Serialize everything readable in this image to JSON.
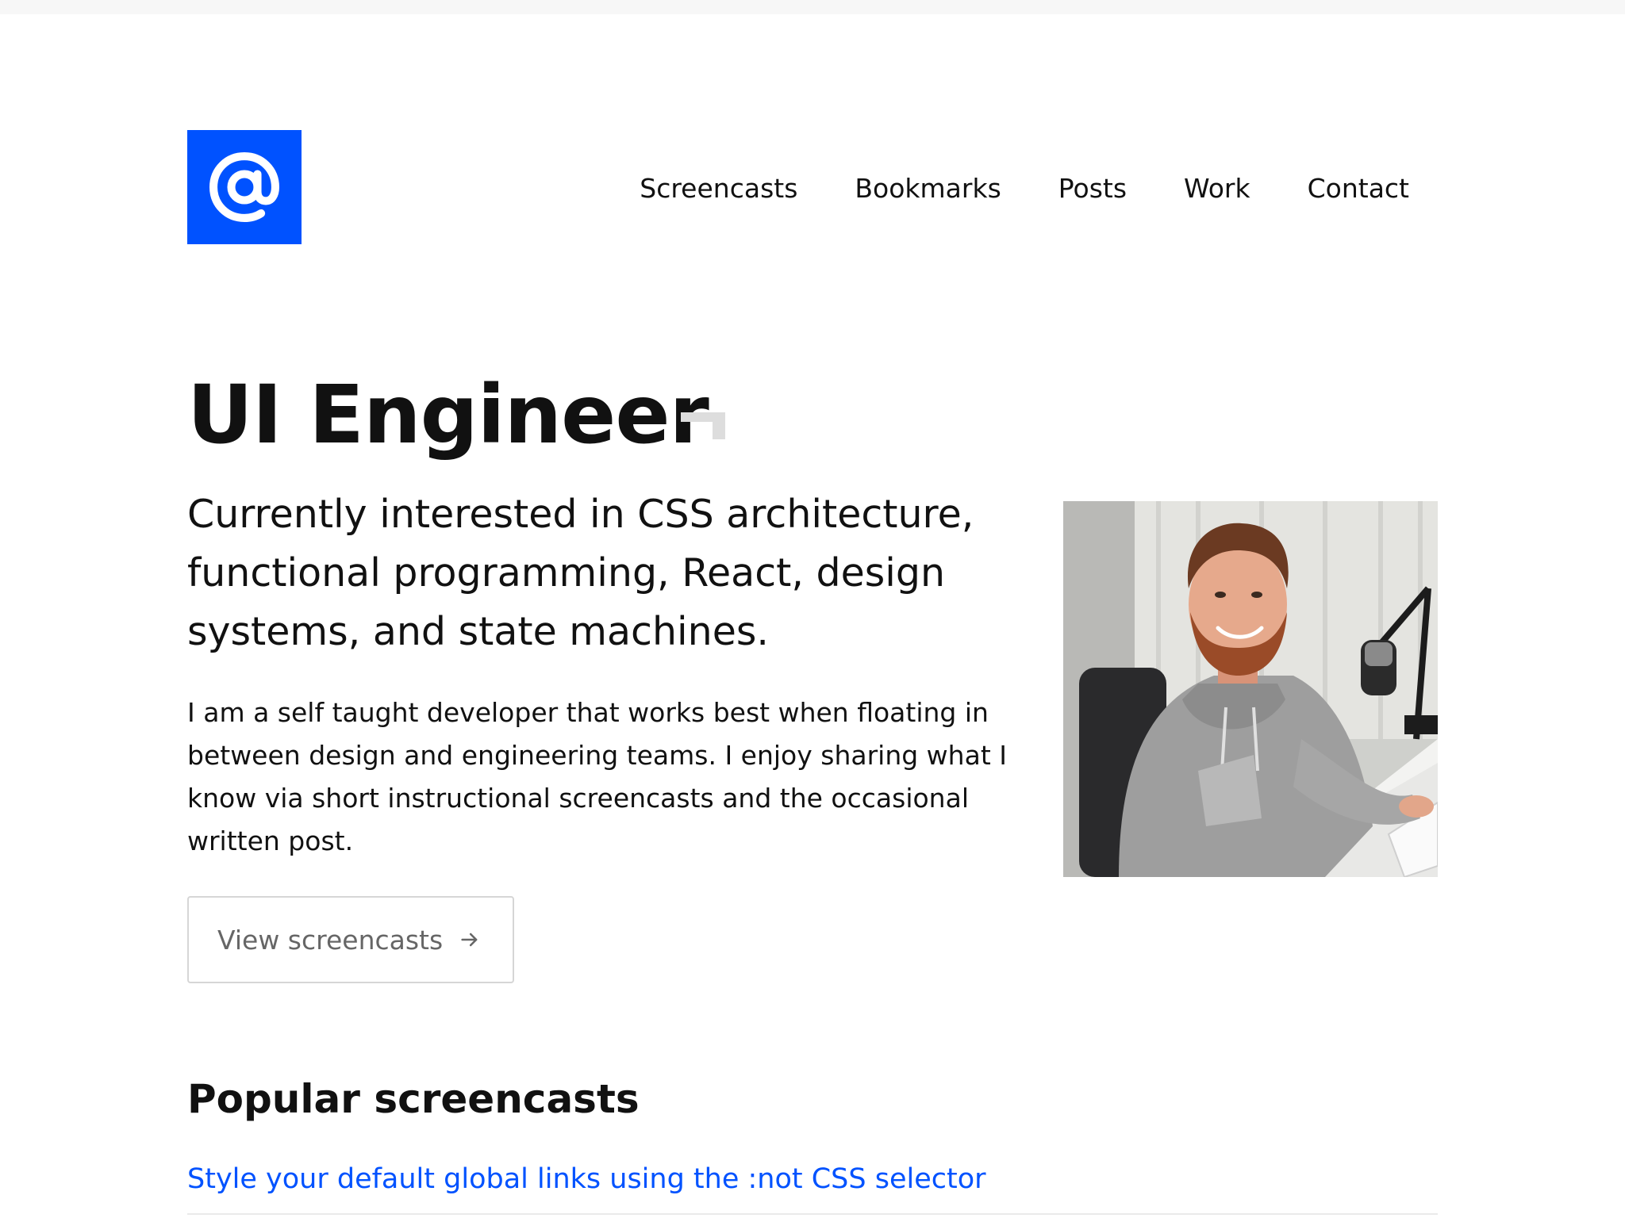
{
  "brand": {
    "logo_glyph": "@",
    "logo_color": "#0052ff"
  },
  "nav": {
    "items": [
      {
        "label": "Screencasts"
      },
      {
        "label": "Bookmarks"
      },
      {
        "label": "Posts"
      },
      {
        "label": "Work"
      },
      {
        "label": "Contact"
      }
    ]
  },
  "hero": {
    "title": "UI Engineer",
    "subtitle": "Currently interested in CSS architecture, functional programming, React, design systems, and state machines.",
    "bio": "I am a self taught developer that works best when floating in between design and engineering teams. I enjoy sharing what I know via short instructional screencasts and the occasional written post.",
    "cta_label": "View screencasts",
    "cta_icon": "arrow-right-icon",
    "photo": "portrait photo of developer at desk with microphone"
  },
  "popular": {
    "heading": "Popular screencasts",
    "items": [
      {
        "title": "Style your default global links using the :not CSS selector"
      }
    ]
  },
  "colors": {
    "accent": "#0052ff",
    "text": "#111111",
    "muted": "#666666",
    "border": "#d6d6d6"
  }
}
